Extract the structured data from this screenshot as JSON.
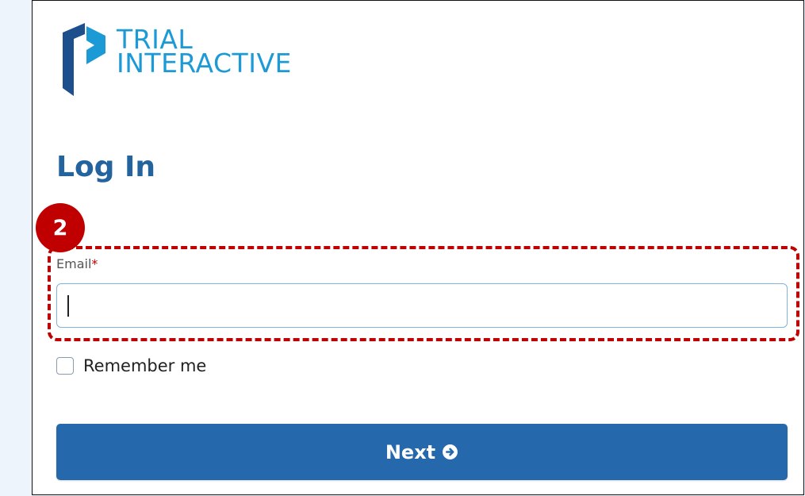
{
  "logo": {
    "line1": "TRIAL",
    "line2": "INTERACTIVE",
    "text_color": "#1c9ad6",
    "mark_dark_color": "#1d4f8c",
    "mark_light_color": "#1c9ad6"
  },
  "page": {
    "title": "Log In",
    "title_color": "#23649e",
    "background_color": "#eef4fb"
  },
  "annotation": {
    "step_number": "2",
    "color": "#c00000"
  },
  "email": {
    "label": "Email",
    "required_marker": "*",
    "value": "",
    "placeholder": ""
  },
  "remember": {
    "label": "Remember me",
    "checked": false
  },
  "next_button": {
    "label": "Next",
    "icon": "arrow-circle-right-icon",
    "color": "#2569ac"
  }
}
